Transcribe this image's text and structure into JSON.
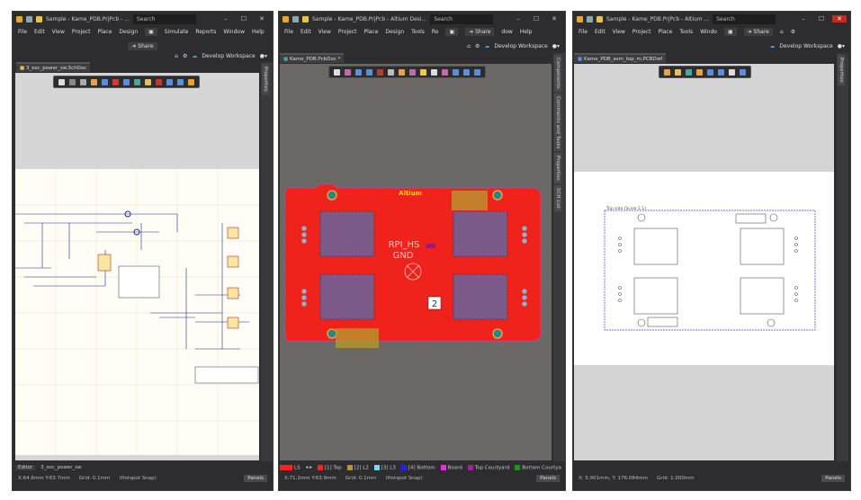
{
  "windows": [
    {
      "title": "Sample - Kame_PDB.PrjPcb - ...",
      "search": "Search",
      "menu": [
        "File",
        "Edit",
        "View",
        "Project",
        "Place",
        "Design",
        "Simulate",
        "Reports",
        "Window",
        "Help"
      ],
      "share": "Share",
      "workspace": "Develop Workspace",
      "tab": "3_esc_power_sw.SchDoc",
      "side_panels": [
        "Properties"
      ],
      "bottom_tabs": [
        "Editor",
        "3_esc_power_sw"
      ],
      "status": {
        "coords": "X:64.6mm Y:63.7mm",
        "grid": "Grid: 0.1mm",
        "snap": "(Hotspot Snap)",
        "panels": "Panels"
      }
    },
    {
      "title": "Sample - Kame_PDB.PrjPcb - Altium Desi...",
      "search": "Search",
      "menu": [
        "File",
        "Edit",
        "View",
        "Project",
        "Place",
        "Design",
        "Tools",
        "Ro",
        "dow",
        "Help"
      ],
      "share": "Share",
      "workspace": "Develop Workspace",
      "tab": "Kame_PDB.PcbDoc *",
      "side_panels": [
        "Components",
        "Comments and Tasks",
        "Properties",
        "SCH List"
      ],
      "layers": [
        {
          "label": "LS",
          "color": "#ff2020"
        },
        {
          "label": "[1] Top",
          "color": "#ff2020"
        },
        {
          "label": "[2] L2",
          "color": "#b8962e"
        },
        {
          "label": "[3] L3",
          "color": "#7fd4f0"
        },
        {
          "label": "[4] Bottom",
          "color": "#2020ff"
        },
        {
          "label": "Board",
          "color": "#ff20ff"
        },
        {
          "label": "Top Courtyard",
          "color": "#a020a0"
        },
        {
          "label": "Bottom Courtya",
          "color": "#209020"
        }
      ],
      "board": {
        "logo": "Altium",
        "net1": "RPI_HS",
        "net2": "GND",
        "marker": "2"
      },
      "status": {
        "coords": "X:71.2mm Y:63.9mm",
        "grid": "Grid: 0.1mm",
        "snap": "(Hotspot Snap)",
        "panels": "Panels"
      }
    },
    {
      "title": "Sample - Kame_PDB.PrjPcb - Altium ...",
      "search": "Search",
      "menu": [
        "File",
        "Edit",
        "View",
        "Project",
        "Place",
        "Tools",
        "Windo"
      ],
      "share": "Share",
      "workspace": "Develop Workspace",
      "tab": "Kame_PDB_asm_top_m.PCBDwf",
      "side_panels": [
        "Properties"
      ],
      "drawing_label": "Top side (Scale 1:1)",
      "status": {
        "coords": "X: 5.901mm, Y: 176.084mm",
        "grid": "Grid: 1.000mm",
        "panels": "Panels"
      }
    }
  ]
}
